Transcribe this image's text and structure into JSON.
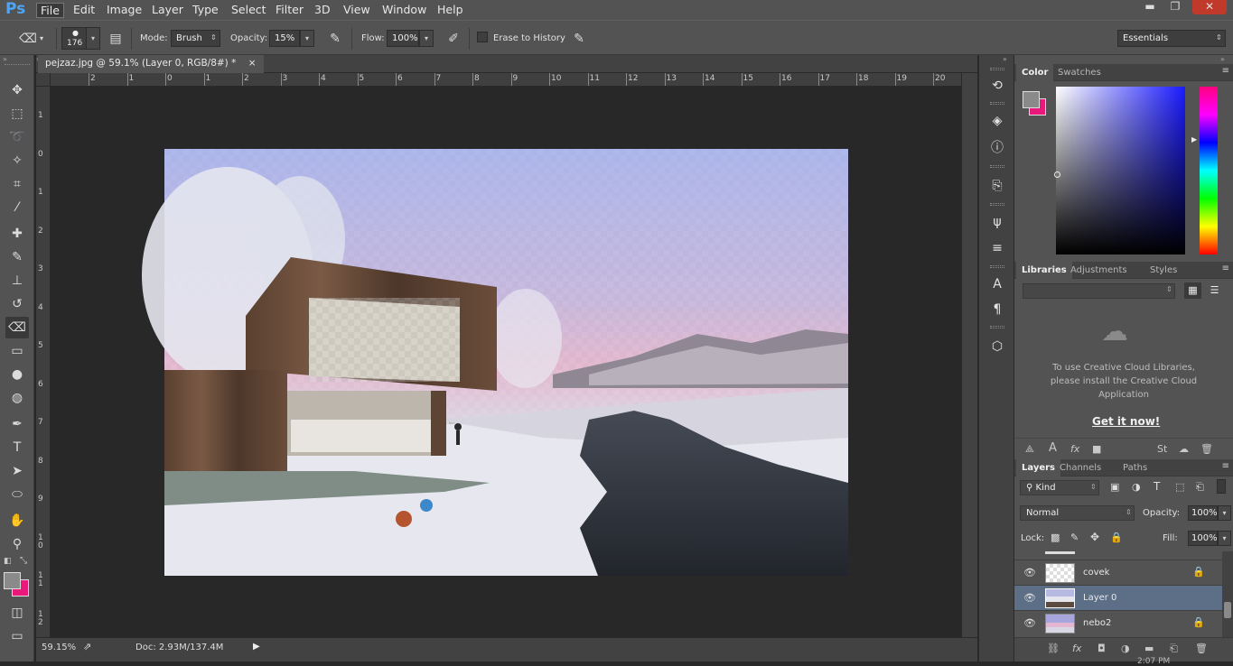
{
  "app": {
    "logo": "Ps"
  },
  "menu": [
    "File",
    "Edit",
    "Image",
    "Layer",
    "Type",
    "Select",
    "Filter",
    "3D",
    "View",
    "Window",
    "Help"
  ],
  "window_buttons": {
    "minimize": "▬",
    "restore": "❐",
    "close": "✕"
  },
  "options": {
    "brush_size": "176",
    "mode_label": "Mode:",
    "mode_value": "Brush",
    "opacity_label": "Opacity:",
    "opacity_value": "15%",
    "flow_label": "Flow:",
    "flow_value": "100%",
    "erase_history_label": "Erase to History",
    "workspace": "Essentials"
  },
  "document": {
    "tab_title": "pejzaz.jpg @ 59.1% (Layer 0, RGB/8#) *",
    "close": "×"
  },
  "ruler": {
    "h_ticks": [
      "2",
      "1",
      "0",
      "1",
      "2",
      "3",
      "4",
      "5",
      "6",
      "7",
      "8",
      "9",
      "10",
      "11",
      "12",
      "13",
      "14",
      "15",
      "16",
      "17",
      "18",
      "19",
      "20"
    ],
    "v_ticks": [
      "1",
      "0",
      "1",
      "2",
      "3",
      "4",
      "5",
      "6",
      "7",
      "8",
      "9",
      "1 0",
      "1 1",
      "1 2"
    ]
  },
  "status": {
    "zoom": "59.15%",
    "doc": "Doc: 2.93M/137.4M"
  },
  "color_panel": {
    "tabs": [
      "Color",
      "Swatches"
    ],
    "foreground": "#8a8a8a",
    "background": "#e8197a"
  },
  "libraries_panel": {
    "tabs": [
      "Libraries",
      "Adjustments",
      "Styles"
    ],
    "message": "To use Creative Cloud Libraries, please install the Creative Cloud Application",
    "link": "Get it now!"
  },
  "layers_panel": {
    "tabs": [
      "Layers",
      "Channels",
      "Paths"
    ],
    "kind_label": "Kind",
    "blend_mode": "Normal",
    "opacity_label": "Opacity:",
    "opacity_value": "100%",
    "lock_label": "Lock:",
    "fill_label": "Fill:",
    "fill_value": "100%",
    "layers": [
      {
        "name": "covek",
        "locked": true,
        "selected": false
      },
      {
        "name": "Layer 0",
        "locked": false,
        "selected": true
      },
      {
        "name": "nebo2",
        "locked": true,
        "selected": false
      }
    ]
  },
  "clock": "2:07 PM"
}
